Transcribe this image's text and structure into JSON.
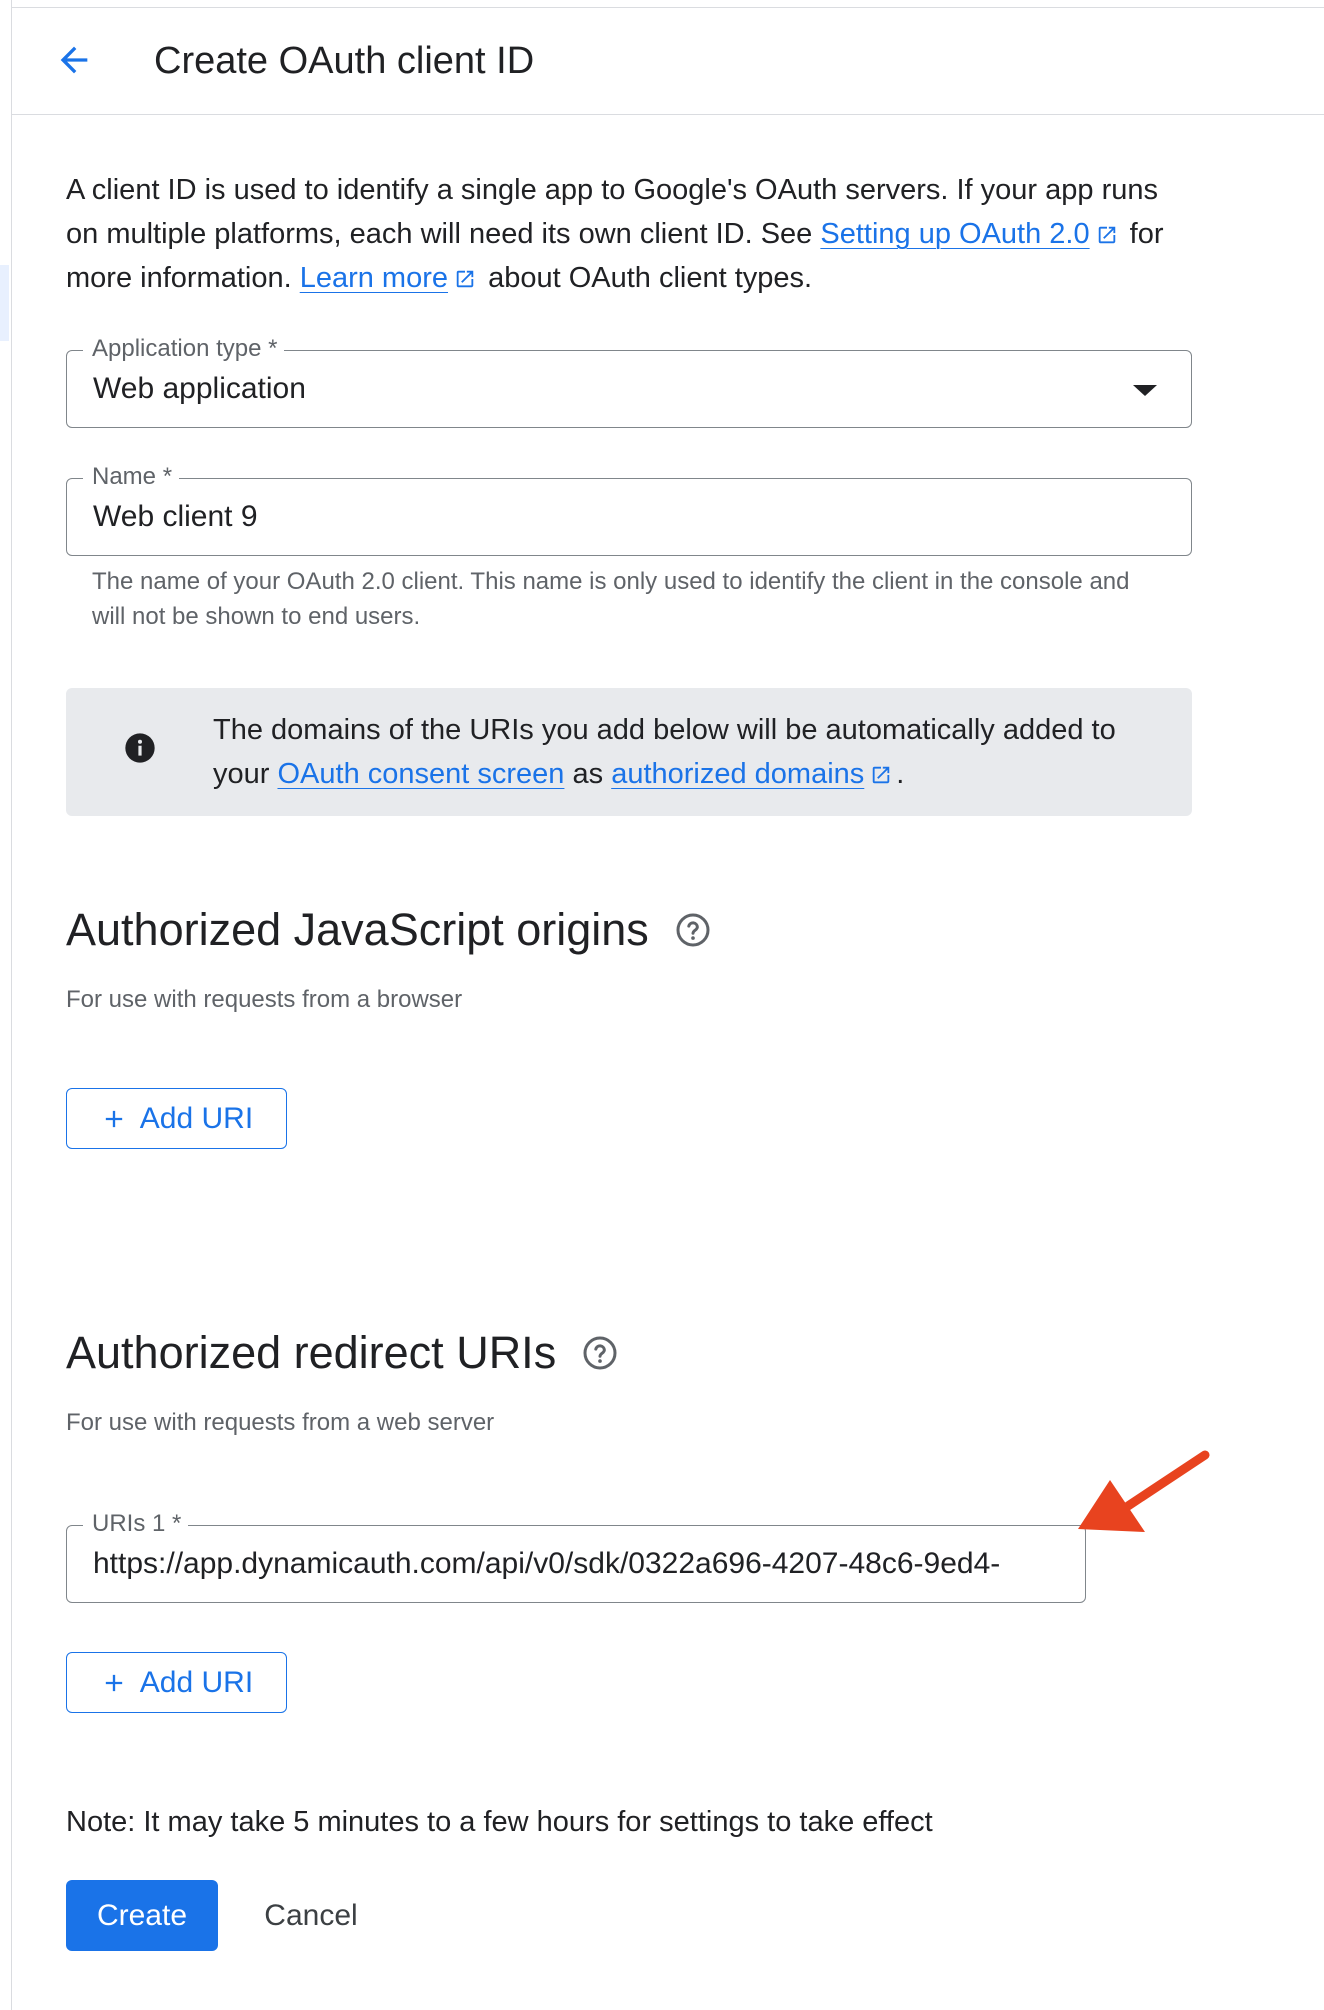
{
  "header": {
    "title": "Create OAuth client ID",
    "back_icon": "arrow-back-icon"
  },
  "intro": {
    "text1": "A client ID is used to identify a single app to Google's OAuth servers. If your app runs on multiple platforms, each will need its own client ID. See ",
    "link1": "Setting up OAuth 2.0",
    "text2": " for more information. ",
    "link2": "Learn more",
    "text3": " about OAuth client types."
  },
  "application_type": {
    "label": "Application type *",
    "value": "Web application"
  },
  "name_field": {
    "label": "Name *",
    "value": "Web client 9",
    "helper": "The name of your OAuth 2.0 client. This name is only used to identify the client in the console and will not be shown to end users."
  },
  "info_box": {
    "text1": "The domains of the URIs you add below will be automatically added to your ",
    "link1": "OAuth consent screen",
    "text2": " as ",
    "link2": "authorized domains",
    "text3": "."
  },
  "js_origins": {
    "title": "Authorized JavaScript origins",
    "subtitle": "For use with requests from a browser",
    "add_label": "Add URI"
  },
  "redirect_uris": {
    "title": "Authorized redirect URIs",
    "subtitle": "For use with requests from a web server",
    "uri_label": "URIs 1 *",
    "uri_value": "https://app.dynamicauth.com/api/v0/sdk/0322a696-4207-48c6-9ed4-",
    "add_label": "Add URI"
  },
  "note": "Note: It may take 5 minutes to a few hours for settings to take effect",
  "actions": {
    "create_label": "Create",
    "cancel_label": "Cancel"
  },
  "colors": {
    "accent": "#1a73e8",
    "annotation_arrow": "#e8431f",
    "info_background": "#e8eaed"
  }
}
